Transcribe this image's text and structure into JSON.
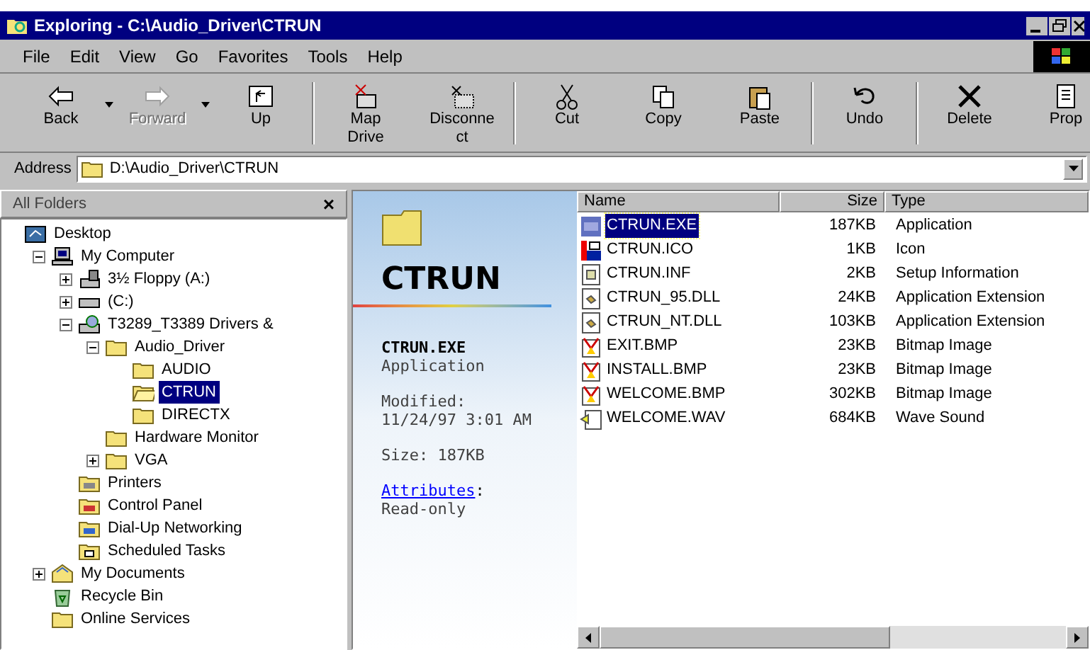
{
  "window": {
    "title": "Exploring - C:\\Audio_Driver\\CTRUN"
  },
  "menu": [
    {
      "label": "File"
    },
    {
      "label": "Edit"
    },
    {
      "label": "View"
    },
    {
      "label": "Go"
    },
    {
      "label": "Favorites"
    },
    {
      "label": "Tools"
    },
    {
      "label": "Help"
    }
  ],
  "toolbar": [
    {
      "buttons": [
        {
          "kind": "back",
          "lines": [
            "Back"
          ],
          "disabled": false,
          "dropdown": true
        },
        {
          "kind": "forward",
          "lines": [
            "Forward"
          ],
          "disabled": true,
          "dropdown": true
        },
        {
          "kind": "up",
          "lines": [
            "Up"
          ],
          "disabled": false,
          "dropdown": false
        }
      ]
    },
    {
      "buttons": [
        {
          "kind": "map",
          "lines": [
            "Map",
            "Drive"
          ],
          "disabled": false,
          "dropdown": false
        },
        {
          "kind": "disconnect",
          "lines": [
            "Disconne",
            "ct"
          ],
          "disabled": false,
          "dropdown": false
        }
      ]
    },
    {
      "buttons": [
        {
          "kind": "cut",
          "lines": [
            "Cut"
          ],
          "disabled": false,
          "dropdown": false
        },
        {
          "kind": "copy",
          "lines": [
            "Copy"
          ],
          "disabled": false,
          "dropdown": false
        },
        {
          "kind": "paste",
          "lines": [
            "Paste"
          ],
          "disabled": false,
          "dropdown": false
        }
      ]
    },
    {
      "buttons": [
        {
          "kind": "undo",
          "lines": [
            "Undo"
          ],
          "disabled": false,
          "dropdown": false
        }
      ]
    },
    {
      "buttons": [
        {
          "kind": "delete",
          "lines": [
            "Delete"
          ],
          "disabled": false,
          "dropdown": false
        },
        {
          "kind": "properties",
          "lines": [
            "Prop"
          ],
          "disabled": false,
          "dropdown": false
        }
      ]
    }
  ],
  "address": {
    "label": "Address",
    "value": "D:\\Audio_Driver\\CTRUN"
  },
  "folders_pane": {
    "title": "All Folders",
    "close": "×"
  },
  "tree": [
    {
      "label": "Desktop",
      "kind": "desktop",
      "selected": false,
      "children": [
        {
          "label": "My Computer",
          "kind": "computer",
          "selected": false,
          "expanded": true,
          "children": [
            {
              "label": "3½ Floppy (A:)",
              "kind": "floppy",
              "selected": false,
              "expanded": false
            },
            {
              "label": "(C:)",
              "kind": "drive",
              "selected": false,
              "expanded": false
            },
            {
              "label": "T3289_T3389 Drivers &",
              "kind": "cd",
              "selected": false,
              "expanded": true,
              "children": [
                {
                  "label": "Audio_Driver",
                  "kind": "folder",
                  "selected": false,
                  "expanded": true,
                  "children": [
                    {
                      "label": "AUDIO",
                      "kind": "folder",
                      "selected": false
                    },
                    {
                      "label": "CTRUN",
                      "kind": "folder-open",
                      "selected": true
                    },
                    {
                      "label": "DIRECTX",
                      "kind": "folder",
                      "selected": false
                    }
                  ]
                },
                {
                  "label": "Hardware Monitor",
                  "kind": "folder",
                  "selected": false
                },
                {
                  "label": "VGA",
                  "kind": "folder",
                  "selected": false,
                  "expanded": false
                }
              ]
            },
            {
              "label": "Printers",
              "kind": "printers",
              "selected": false
            },
            {
              "label": "Control Panel",
              "kind": "control",
              "selected": false
            },
            {
              "label": "Dial-Up Networking",
              "kind": "dialup",
              "selected": false
            },
            {
              "label": "Scheduled Tasks",
              "kind": "tasks",
              "selected": false
            }
          ]
        },
        {
          "label": "My Documents",
          "kind": "documents",
          "selected": false,
          "expanded": false
        },
        {
          "label": "Recycle Bin",
          "kind": "recycle",
          "selected": false
        },
        {
          "label": "Online Services",
          "kind": "folder",
          "selected": false
        }
      ]
    }
  ],
  "web_view": {
    "heading": "CTRUN",
    "file_name": "CTRUN.EXE",
    "file_type": "Application",
    "modified_label": "Modified:",
    "modified": "11/24/97 3:01 AM",
    "size": "Size: 187KB",
    "attributes_link": "Attributes",
    "attributes_colon": ":",
    "attributes": "Read-only"
  },
  "file_list": {
    "columns": [
      "Name",
      "Size",
      "Type"
    ],
    "rows": [
      {
        "name": "CTRUN.EXE",
        "size": "187KB",
        "type": "Application",
        "kind": "exe",
        "selected": true
      },
      {
        "name": "CTRUN.ICO",
        "size": "1KB",
        "type": "Icon",
        "kind": "ico",
        "selected": false
      },
      {
        "name": "CTRUN.INF",
        "size": "2KB",
        "type": "Setup Information",
        "kind": "inf",
        "selected": false
      },
      {
        "name": "CTRUN_95.DLL",
        "size": "24KB",
        "type": "Application Extension",
        "kind": "dll",
        "selected": false
      },
      {
        "name": "CTRUN_NT.DLL",
        "size": "103KB",
        "type": "Application Extension",
        "kind": "dll",
        "selected": false
      },
      {
        "name": "EXIT.BMP",
        "size": "23KB",
        "type": "Bitmap Image",
        "kind": "bmp",
        "selected": false
      },
      {
        "name": "INSTALL.BMP",
        "size": "23KB",
        "type": "Bitmap Image",
        "kind": "bmp",
        "selected": false
      },
      {
        "name": "WELCOME.BMP",
        "size": "302KB",
        "type": "Bitmap Image",
        "kind": "bmp",
        "selected": false
      },
      {
        "name": "WELCOME.WAV",
        "size": "684KB",
        "type": "Wave Sound",
        "kind": "wav",
        "selected": false
      }
    ]
  }
}
